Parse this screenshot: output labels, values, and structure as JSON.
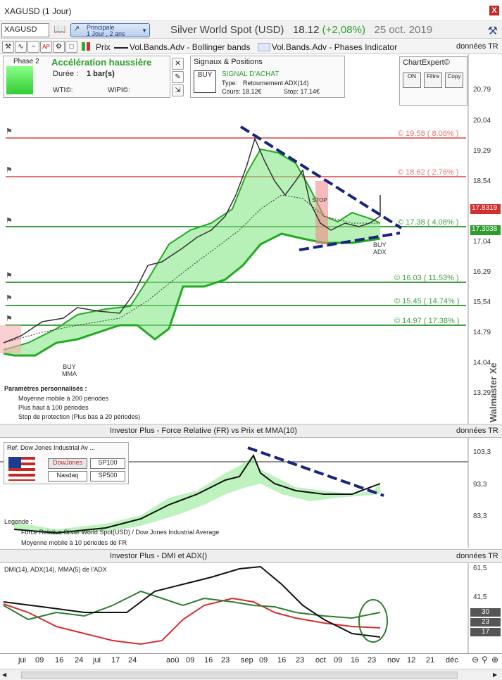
{
  "window": {
    "title": "XAGUSD (1 Jour)",
    "close": "X"
  },
  "toolbar": {
    "symbol": "XAGUSD",
    "period_main": "Principale",
    "period_sub": "1 Jour , 2 ans",
    "instrument": "Silver World Spot (USD)",
    "price": "18.12",
    "change": "(+2,08%)",
    "date": "25 oct. 2019"
  },
  "indicators_bar": {
    "prix": "Prix",
    "bollinger": "Vol.Bands.Adv - Bollinger bands",
    "phases": "Vol.Bands.Adv - Phases Indicator",
    "donnees": "données TR"
  },
  "phase_panel": {
    "phase": "Phase 2",
    "title": "Accélération haussière",
    "duree_label": "Durée :",
    "duree_value": "1 bar(s)",
    "wti": "WTI©:",
    "wipi": "WIPI©:"
  },
  "signals_panel": {
    "title": "Signaux & Positions",
    "badge": "BUY",
    "signal": "SIGNAL D'ACHAT",
    "type_label": "Type:",
    "type_value": "Retournement ADX(14)",
    "cours": "Cours: 18.12€",
    "stop": "Stop: 17.14€"
  },
  "chartexpert": {
    "title": "ChartExpert©",
    "on": "ON",
    "filtre": "Filtre",
    "copy": "Copy"
  },
  "price_axis": [
    "20,79",
    "20,04",
    "19,29",
    "18,54",
    "17,04",
    "16,29",
    "15,54",
    "14,79",
    "14,04",
    "13,29"
  ],
  "price_badges": {
    "current": "17.8319",
    "support": "17.3038",
    "support_color": "#2e9d2e",
    "current_color": "#d32f2f"
  },
  "levels": [
    {
      "label": "© 19.58 ( 8.06% )",
      "color": "#e57373"
    },
    {
      "label": "© 18.62 ( 2.76% )",
      "color": "#e57373"
    },
    {
      "label": "© 17.38 ( 4.08% )",
      "color": "#43a047"
    },
    {
      "label": "© 16.03 ( 11.53% )",
      "color": "#43a047"
    },
    {
      "label": "© 15.45 ( 14.74% )",
      "color": "#43a047"
    },
    {
      "label": "© 14.97 ( 17.38% )",
      "color": "#43a047"
    }
  ],
  "annotations": {
    "buy1": "BUY",
    "mma": "MMA",
    "buy2": "BUY",
    "adx": "ADX",
    "stop": "STOP"
  },
  "legend_main": {
    "title": "Paramètres personnalisés :",
    "items": [
      "Moyenne mobile à 200 périodes",
      "Plus haut à 100 périodes",
      "Stop de protection (Plus bas à 20 périodes)"
    ]
  },
  "watermark": "Walmaster Xe",
  "investor1": {
    "title": "Investor Plus - Force Relative (FR) vs Prix et MMA(10)",
    "donnees": "données TR",
    "ref": "Ref: Dow Jones Industrial Av ...",
    "buttons": [
      "DowJones",
      "SP100",
      "Nasdaq",
      "SP500"
    ],
    "axis": [
      "103,3",
      "93,3",
      "83,3"
    ],
    "legend_title": "Legende :",
    "legend_items": [
      "Force Relative Silver World Spot(USD) / Dow Jones Industrial Average",
      "Moyenne mobile à 10 périodes de FR"
    ]
  },
  "investor2": {
    "title": "Investor Plus - DMI et ADX()",
    "donnees": "données TR",
    "sub": "DMI(14), ADX(14), MMA(5) de l'ADX",
    "axis": [
      "61,5",
      "41,5"
    ],
    "badges": [
      "30",
      "23",
      "17"
    ]
  },
  "time_axis": [
    "jui",
    "09",
    "16",
    "24",
    "jui",
    "17",
    "24",
    "aoû",
    "09",
    "16",
    "23",
    "sep",
    "09",
    "16",
    "23",
    "oct",
    "09",
    "16",
    "23",
    "nov",
    "12",
    "21",
    "déc"
  ],
  "colors": {
    "accent": "#2a4d8f",
    "up": "#00c800",
    "down": "#e53935",
    "trend": "#1a237e"
  }
}
